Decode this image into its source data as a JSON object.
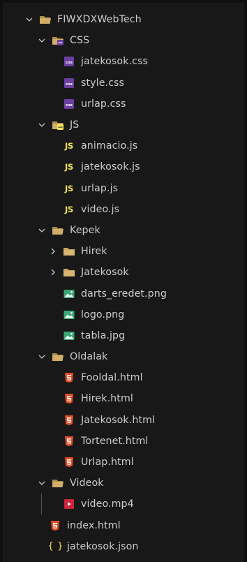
{
  "explorer": {
    "root": {
      "label": "FIWXDXWebTech",
      "icon": "folder-open-icon"
    },
    "css_folder": {
      "label": "CSS",
      "icon": "css-folder-open-icon",
      "files": [
        {
          "label": "jatekosok.css",
          "icon": "css-file-icon"
        },
        {
          "label": "style.css",
          "icon": "css-file-icon"
        },
        {
          "label": "urlap.css",
          "icon": "css-file-icon"
        }
      ]
    },
    "js_folder": {
      "label": "JS",
      "icon": "js-folder-open-icon",
      "files": [
        {
          "label": "animacio.js",
          "icon": "js-file-icon",
          "glyph": "JS"
        },
        {
          "label": "jatekosok.js",
          "icon": "js-file-icon",
          "glyph": "JS"
        },
        {
          "label": "urlap.js",
          "icon": "js-file-icon",
          "glyph": "JS"
        },
        {
          "label": "video.js",
          "icon": "js-file-icon",
          "glyph": "JS"
        }
      ]
    },
    "kepek_folder": {
      "label": "Kepek",
      "icon": "folder-open-icon",
      "subfolders": [
        {
          "label": "Hirek",
          "icon": "folder-closed-icon"
        },
        {
          "label": "Jatekosok",
          "icon": "folder-closed-icon"
        }
      ],
      "files": [
        {
          "label": "darts_eredet.png",
          "icon": "image-file-icon"
        },
        {
          "label": "logo.png",
          "icon": "image-file-icon"
        },
        {
          "label": "tabla.jpg",
          "icon": "image-file-icon"
        }
      ]
    },
    "oldalak_folder": {
      "label": "Oldalak",
      "icon": "folder-open-icon",
      "files": [
        {
          "label": "Fooldal.html",
          "icon": "html5-file-icon"
        },
        {
          "label": "Hirek.html",
          "icon": "html5-file-icon"
        },
        {
          "label": "Jatekosok.html",
          "icon": "html5-file-icon"
        },
        {
          "label": "Tortenet.html",
          "icon": "html5-file-icon"
        },
        {
          "label": "Urlap.html",
          "icon": "html5-file-icon"
        }
      ]
    },
    "videok_folder": {
      "label": "Videok",
      "icon": "folder-open-icon",
      "files": [
        {
          "label": "video.mp4",
          "icon": "video-file-icon"
        }
      ]
    },
    "root_files": [
      {
        "label": "index.html",
        "icon": "html5-file-icon"
      },
      {
        "label": "jatekosok.json",
        "icon": "json-file-icon",
        "glyph": "{ }"
      }
    ],
    "colors": {
      "background": "#181818",
      "text": "#cccccc",
      "folder": "#c9a45c",
      "html": "#e44d26",
      "css_file": "#6a3fa0",
      "js": "#f1e05a",
      "image": "#3aa675",
      "video": "#c8253b",
      "json": "#f5de5c"
    }
  }
}
